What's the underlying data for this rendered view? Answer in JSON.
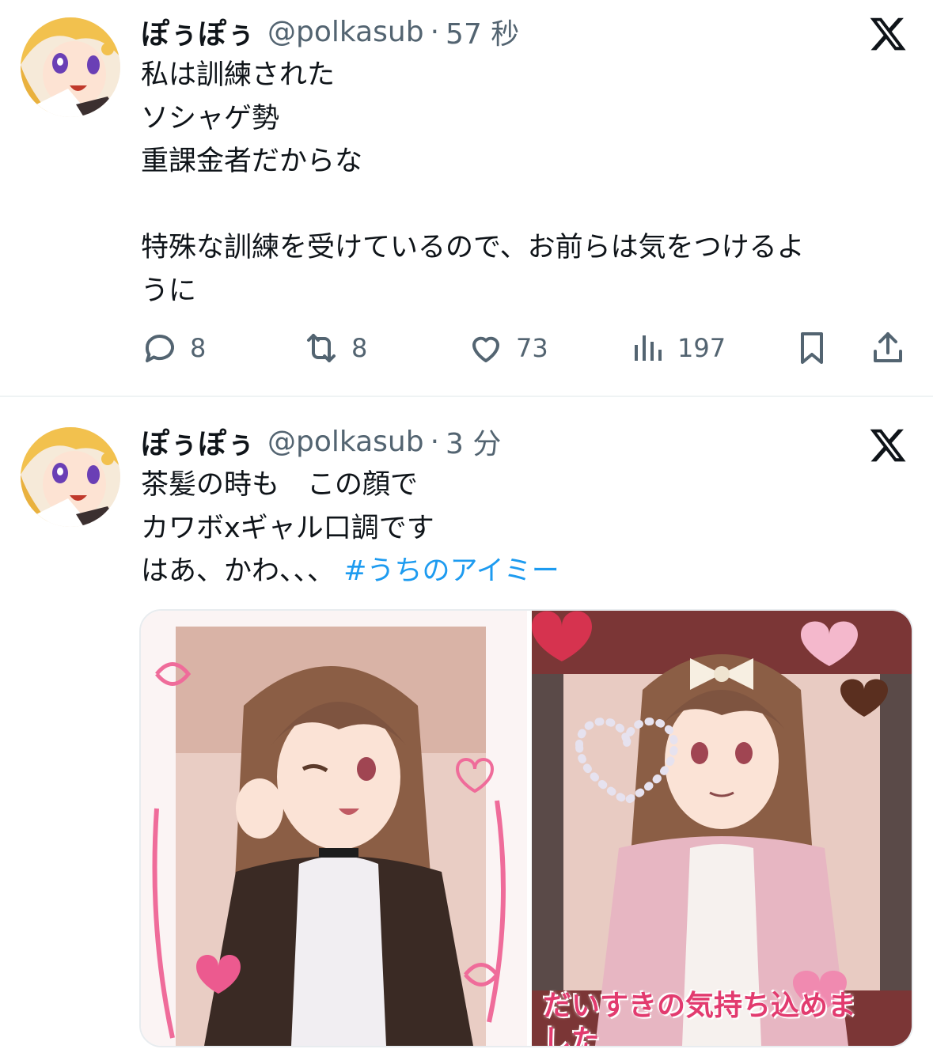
{
  "tweets": [
    {
      "display_name": "ぽぅぽぅ",
      "handle": "@polkasub",
      "time": "57 秒",
      "text_lines": [
        "私は訓練された",
        "ソシャゲ勢",
        "重課金者だからな",
        "",
        "特殊な訓練を受けているので、お前らは気をつけるよ",
        "うに"
      ],
      "actions": {
        "reply_count": "8",
        "retweet_count": "8",
        "like_count": "73",
        "views_count": "197"
      }
    },
    {
      "display_name": "ぽぅぽぅ",
      "handle": "@polkasub",
      "time": "3 分",
      "text_lines": [
        "茶髪の時も　この顔で",
        "カワボxギャル口調です",
        "はあ、かわ、、、"
      ],
      "hashtag": "#うちのアイミー",
      "image_caption": "だいすきの気持ち込めました"
    }
  ],
  "icons": {
    "platform": "x-logo-icon",
    "reply": "speech-bubble-icon",
    "retweet": "retweet-icon",
    "like": "heart-icon",
    "views": "bar-chart-icon",
    "bookmark": "bookmark-icon",
    "share": "share-icon"
  },
  "colors": {
    "text": "#0f1419",
    "secondary": "#536471",
    "hashtag": "#1d9bf0",
    "divider": "#eff3f4"
  }
}
